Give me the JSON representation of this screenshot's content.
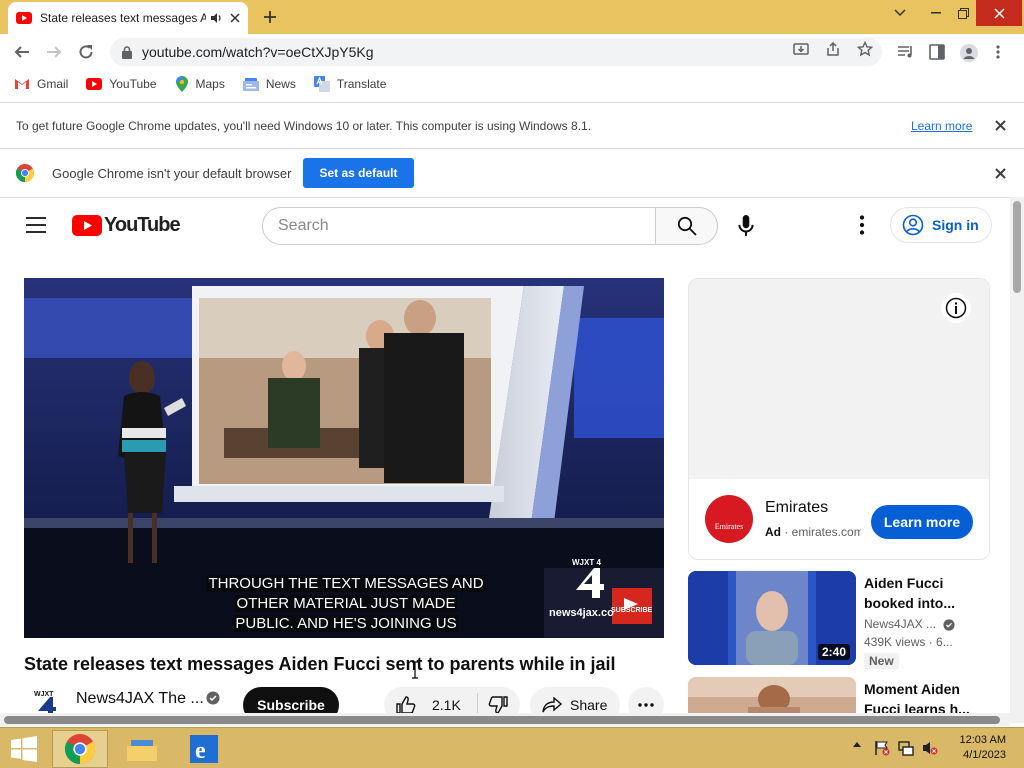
{
  "browser": {
    "tab_title": "State releases text messages Aiden Fucci sent to parents while in jail",
    "url": "youtube.com/watch?v=oeCtXJpY5Kg",
    "bookmarks": [
      {
        "label": "Gmail",
        "icon": "gmail-icon"
      },
      {
        "label": "YouTube",
        "icon": "youtube-icon"
      },
      {
        "label": "Maps",
        "icon": "maps-icon"
      },
      {
        "label": "News",
        "icon": "news-icon"
      },
      {
        "label": "Translate",
        "icon": "translate-icon"
      }
    ],
    "update_bar": {
      "message": "To get future Google Chrome updates, you'll need Windows 10 or later. This computer is using Windows 8.1.",
      "link": "Learn more"
    },
    "default_bar": {
      "message": "Google Chrome isn't your default browser",
      "button": "Set as default"
    }
  },
  "youtube": {
    "logo_text": "YouTube",
    "search_placeholder": "Search",
    "sign_in": "Sign in",
    "video": {
      "title": "State releases text messages Aiden Fucci sent to parents while in jail",
      "caption_lines": [
        "THROUGH THE TEXT MESSAGES AND",
        "OTHER MATERIAL JUST MADE",
        "PUBLIC. AND HE'S JOINING US"
      ],
      "station_logo": "WJXT 4",
      "station_url": "news4jax.co",
      "subscribe_watermark": "SUBSCRIBE"
    },
    "channel": {
      "name": "News4JAX The ...",
      "subscribe": "Subscribe",
      "likes": "2.1K",
      "share": "Share"
    },
    "ad": {
      "advertiser": "Emirates",
      "ad_label": "Ad",
      "domain": "emirates.com",
      "logo_text": "Emirates",
      "cta": "Learn more"
    },
    "recommendations": [
      {
        "title": "Aiden Fucci booked into...",
        "channel": "News4JAX ...",
        "meta": "439K views · 6...",
        "duration": "2:40",
        "badge": "New"
      },
      {
        "title": "Moment Aiden Fucci learns h...",
        "channel": "",
        "meta": "",
        "duration": "",
        "badge": ""
      }
    ]
  },
  "taskbar": {
    "time": "12:03 AM",
    "date": "4/1/2023"
  },
  "colors": {
    "tab_strip": "#e8c35f",
    "youtube_red": "#ff0000",
    "link_blue": "#065fd4",
    "chrome_blue": "#1a73e8",
    "taskbar": "#d9b968"
  }
}
